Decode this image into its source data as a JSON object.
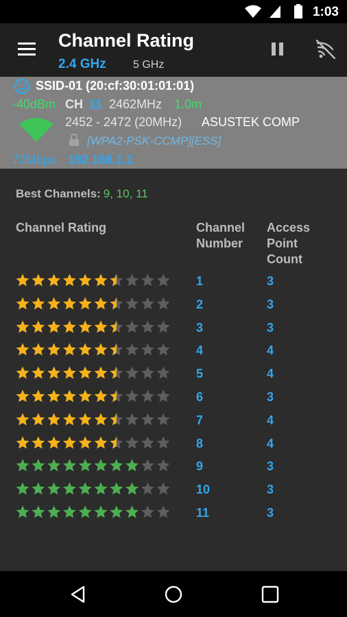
{
  "status_bar": {
    "time": "1:03"
  },
  "app_bar": {
    "title": "Channel Rating",
    "bands": [
      {
        "label": "2.4 GHz",
        "selected": true
      },
      {
        "label": "5 GHz",
        "selected": false
      }
    ],
    "actions": [
      "pause-icon",
      "wifi-scan-icon"
    ]
  },
  "access_point": {
    "ssid": "SSID-01 (20:cf:30:01:01:01)",
    "level": "-40dBm",
    "ch_label": "CH",
    "channel": "11",
    "frequency": "2462MHz",
    "distance": "1.0m",
    "range": "2452 - 2472 (20MHz)",
    "vendor": "ASUSTEK COMP",
    "security": "[WPA2-PSK-CCMP][ESS]",
    "rate": "72Mbps",
    "ip": "192.168.1.1"
  },
  "best_channels": {
    "label": "Best Channels:",
    "value": "9, 10, 11"
  },
  "table": {
    "headers": {
      "rating": "Channel Rating",
      "number": "Channel\nNumber",
      "count": "Access\nPoint\nCount"
    },
    "max_stars": 10,
    "rows": [
      {
        "rating": 6.5,
        "channel": "1",
        "count": "3"
      },
      {
        "rating": 6.5,
        "channel": "2",
        "count": "3"
      },
      {
        "rating": 6.5,
        "channel": "3",
        "count": "3"
      },
      {
        "rating": 6.5,
        "channel": "4",
        "count": "4"
      },
      {
        "rating": 6.5,
        "channel": "5",
        "count": "4"
      },
      {
        "rating": 6.5,
        "channel": "6",
        "count": "3"
      },
      {
        "rating": 6.5,
        "channel": "7",
        "count": "4"
      },
      {
        "rating": 6.5,
        "channel": "8",
        "count": "4"
      },
      {
        "rating": 8,
        "channel": "9",
        "count": "3"
      },
      {
        "rating": 8,
        "channel": "10",
        "count": "3"
      },
      {
        "rating": 8,
        "channel": "11",
        "count": "3"
      }
    ]
  },
  "colors": {
    "accent": "#33a6ee",
    "star_yellow": "#f5b21a",
    "star_green": "#4caf50",
    "star_empty": "#5e5e5e"
  }
}
